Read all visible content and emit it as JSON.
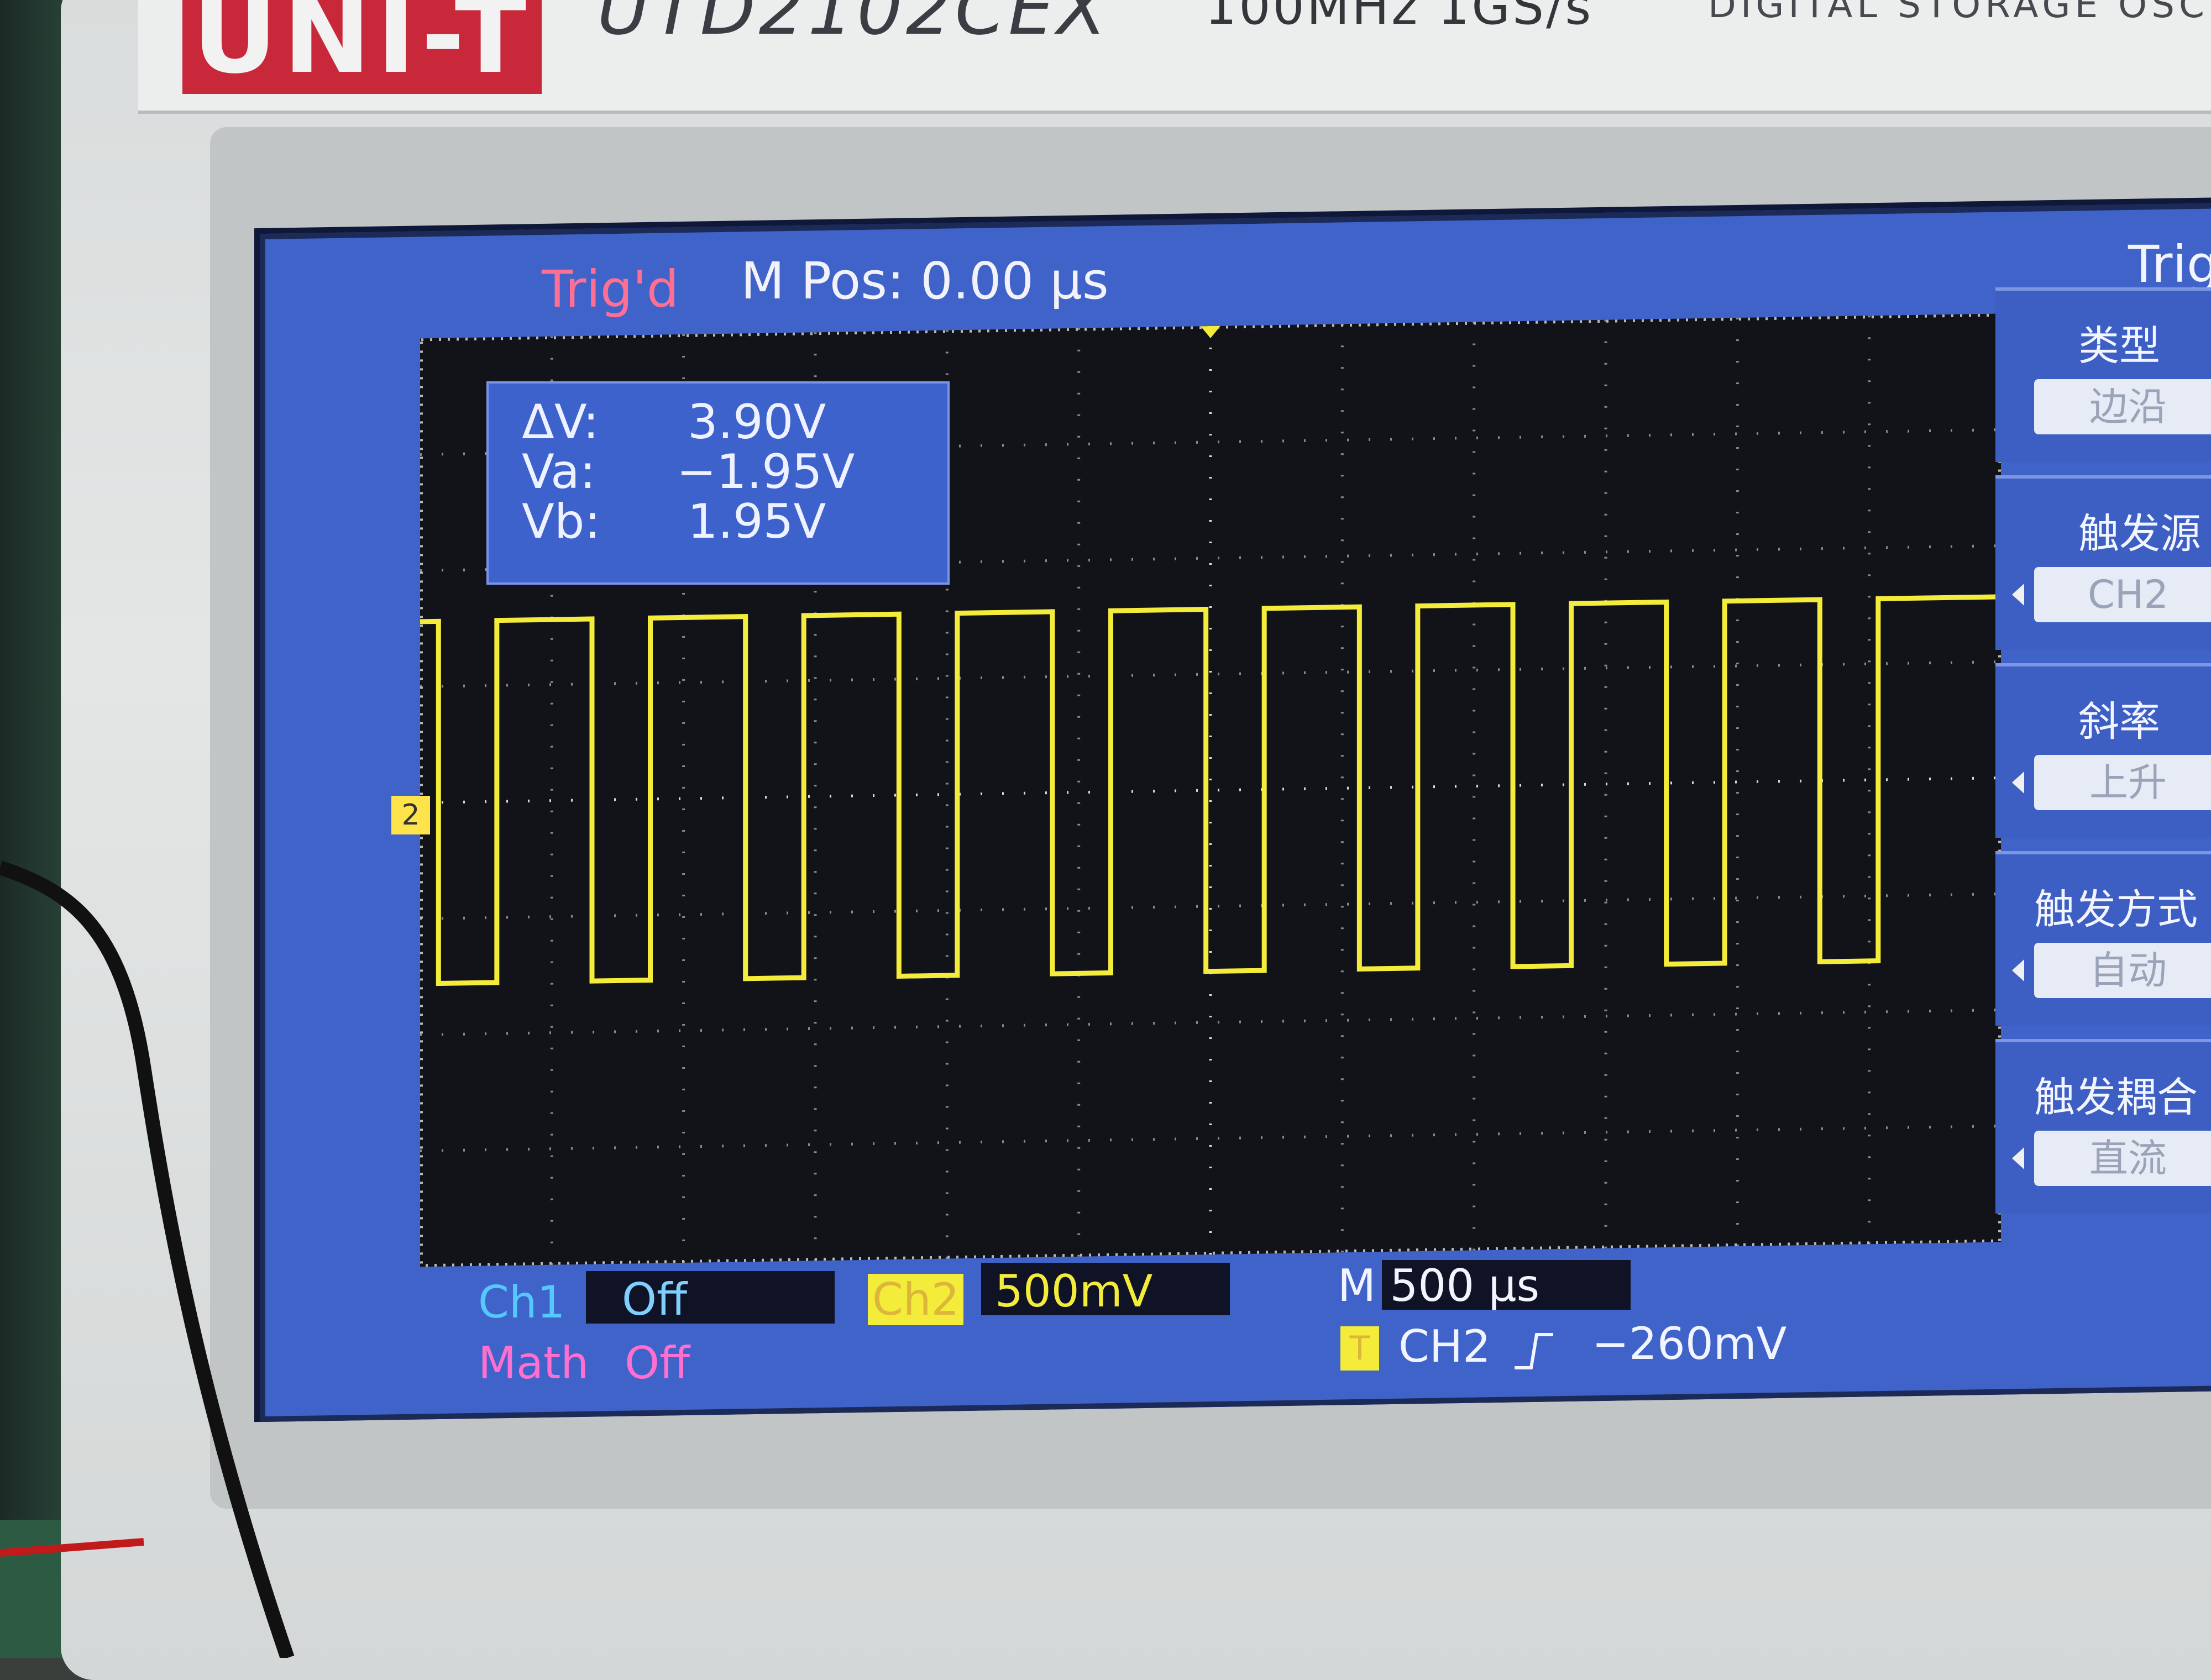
{
  "device": {
    "brand": "UNI-T",
    "model": "UTD2102CEX",
    "spec": "100MHz  1GS/s",
    "description": "DIGITAL STORAGE OSC"
  },
  "status": {
    "trigger_state": "Trig'd",
    "main_position": "M Pos: 0.00 µs"
  },
  "cursor_readout": {
    "delta_label": "ΔV:",
    "delta_value": "3.90V",
    "a_label": "Va:",
    "a_value": "−1.95V",
    "b_label": "Vb:",
    "b_value": "1.95V"
  },
  "channel_marker": "2",
  "side_menu": {
    "header": "Trig",
    "items": [
      {
        "title": "类型",
        "value": "边沿"
      },
      {
        "title": "触发源",
        "value": "CH2"
      },
      {
        "title": "斜率",
        "value": "上升"
      },
      {
        "title": "触发方式",
        "value": "自动"
      },
      {
        "title": "触发耦合",
        "value": "直流"
      }
    ]
  },
  "bottom_bar": {
    "ch1_label": "Ch1",
    "ch1_value": "Off",
    "math_label": "Math",
    "math_value": "Off",
    "ch2_label": "Ch2",
    "ch2_value": "500mV",
    "timebase": "M 500 µs",
    "trigger_icon": "T",
    "trigger_source": "CH2",
    "trigger_slope_icon": "rising-edge",
    "trigger_level": "−260mV"
  },
  "colors": {
    "lcd_background": "#3f63c8",
    "grid_background": "#121219",
    "trace": "#f4ec3a",
    "trig_status": "#ff6f93",
    "math_label": "#ff6fd0",
    "ch1_label": "#54c8ff"
  },
  "chart_data": {
    "type": "line",
    "series": [
      {
        "name": "CH2",
        "waveform": "square",
        "high_level_V": 1.95,
        "low_level_V": -1.95,
        "amplitude_V": 3.9,
        "low_pulses_visible": 10
      }
    ],
    "volts_per_div": "500mV",
    "time_per_div": "500 µs",
    "grid": true
  }
}
